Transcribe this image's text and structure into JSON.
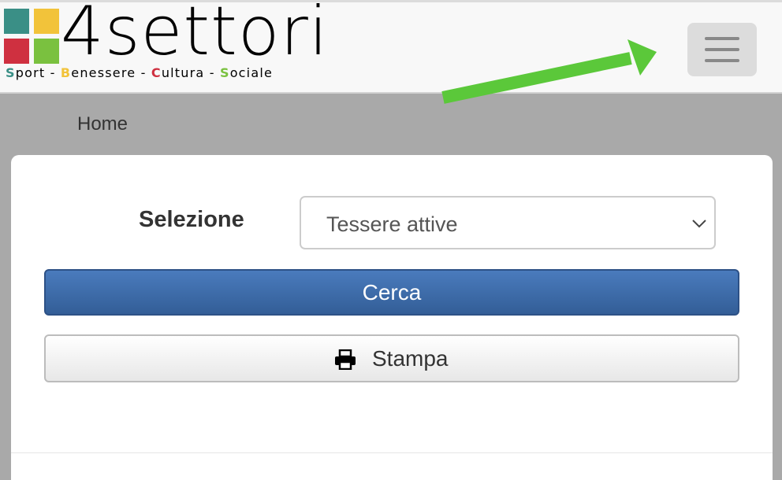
{
  "logo": {
    "text": "4settori",
    "tagline": [
      {
        "initial": "S",
        "rest": "port",
        "color": "#3a8f86"
      },
      {
        "sep": " - "
      },
      {
        "initial": "B",
        "rest": "enessere",
        "color": "#f2c33a"
      },
      {
        "sep": " - "
      },
      {
        "initial": "C",
        "rest": "ultura",
        "color": "#cf3040"
      },
      {
        "sep": " - "
      },
      {
        "initial": "S",
        "rest": "ociale",
        "color": "#7ac13f"
      }
    ],
    "square_colors": [
      "#3a8f86",
      "#f2c33a",
      "#cf3040",
      "#7ac13f"
    ]
  },
  "navbar": {
    "menu_icon": "hamburger-icon"
  },
  "annotation": {
    "arrow_color": "#5bc83a"
  },
  "breadcrumb": {
    "home": "Home"
  },
  "form": {
    "selezione_label": "Selezione",
    "select_value": "Tessere attive",
    "cerca_label": "Cerca",
    "stampa_label": "Stampa",
    "stampa_icon": "print-icon"
  }
}
